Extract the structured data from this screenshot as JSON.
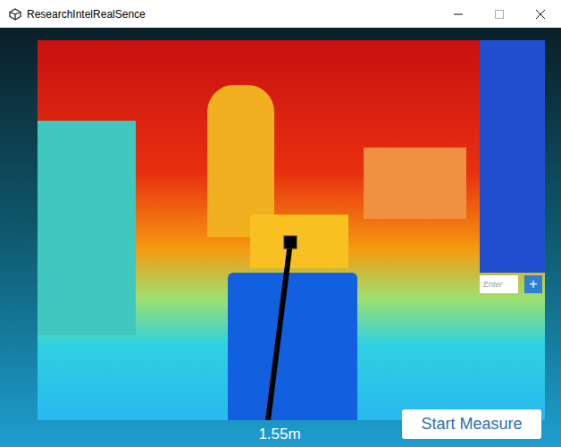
{
  "window": {
    "title": "ResearchIntelRealSence"
  },
  "depth_view": {
    "distance_reading": "1.55m"
  },
  "point_input": {
    "placeholder": "Enter",
    "add_button": "+"
  },
  "buttons": [
    "Start Measure"
  ]
}
